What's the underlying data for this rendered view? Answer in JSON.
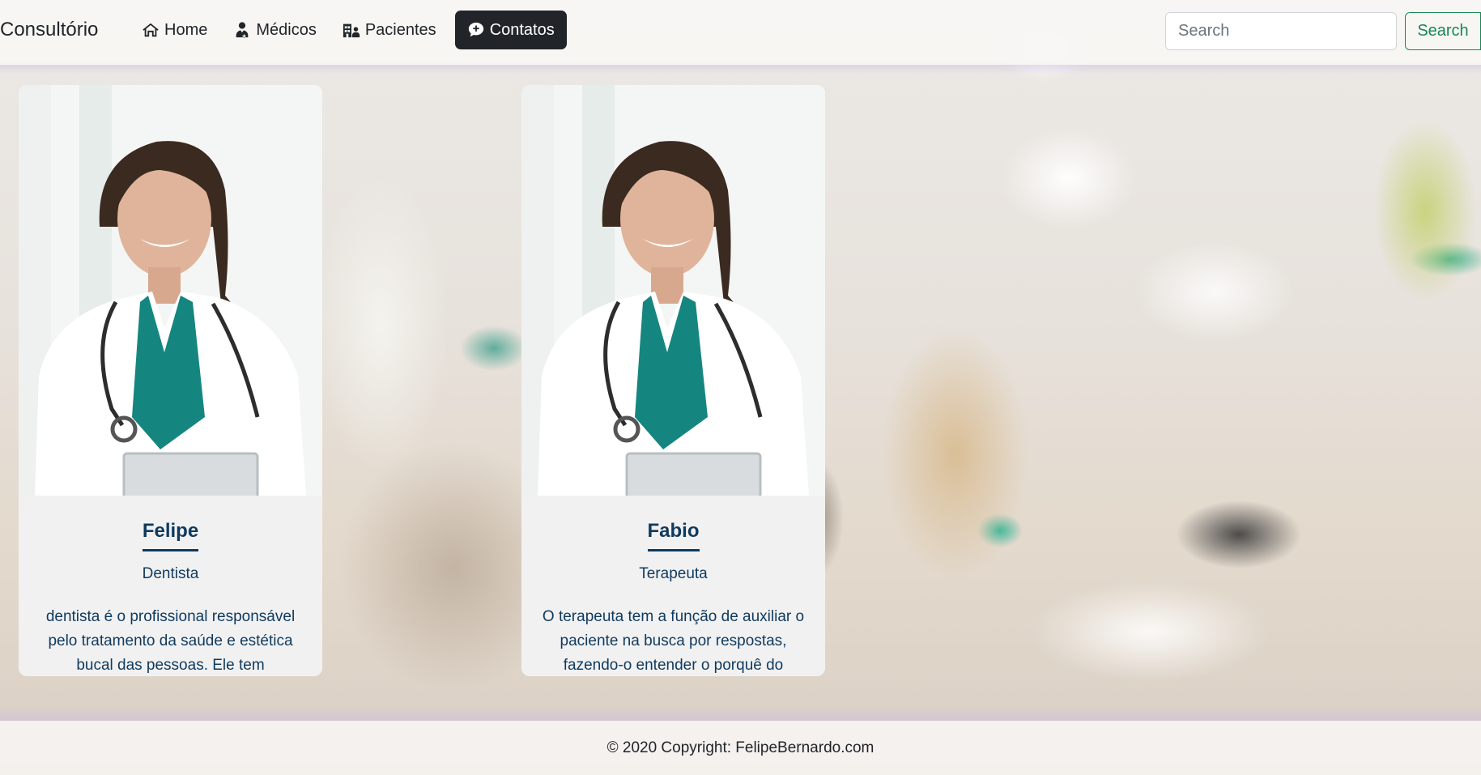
{
  "navbar": {
    "brand": "Consultório",
    "links": [
      {
        "label": "Home",
        "icon": "home-icon"
      },
      {
        "label": "Médicos",
        "icon": "doctor-icon"
      },
      {
        "label": "Pacientes",
        "icon": "hospital-users-icon"
      },
      {
        "label": "Contatos",
        "icon": "chat-icon",
        "active": true
      }
    ],
    "search": {
      "placeholder": "Search",
      "button_label": "Search"
    }
  },
  "cards": [
    {
      "name": "Felipe",
      "role": "Dentista",
      "description": "dentista é o profissional responsável pelo tratamento da saúde e estética bucal das pessoas. Ele tem"
    },
    {
      "name": "Fabio",
      "role": "Terapeuta",
      "description": "O terapeuta tem a função de auxiliar o paciente na busca por respostas, fazendo-o entender o porquê do"
    }
  ],
  "footer": {
    "text": "© 2020 Copyright: FelipeBernardo.com"
  },
  "colors": {
    "accent": "#198754",
    "card_text": "#0e3a5f",
    "active_nav_bg": "#212529"
  }
}
